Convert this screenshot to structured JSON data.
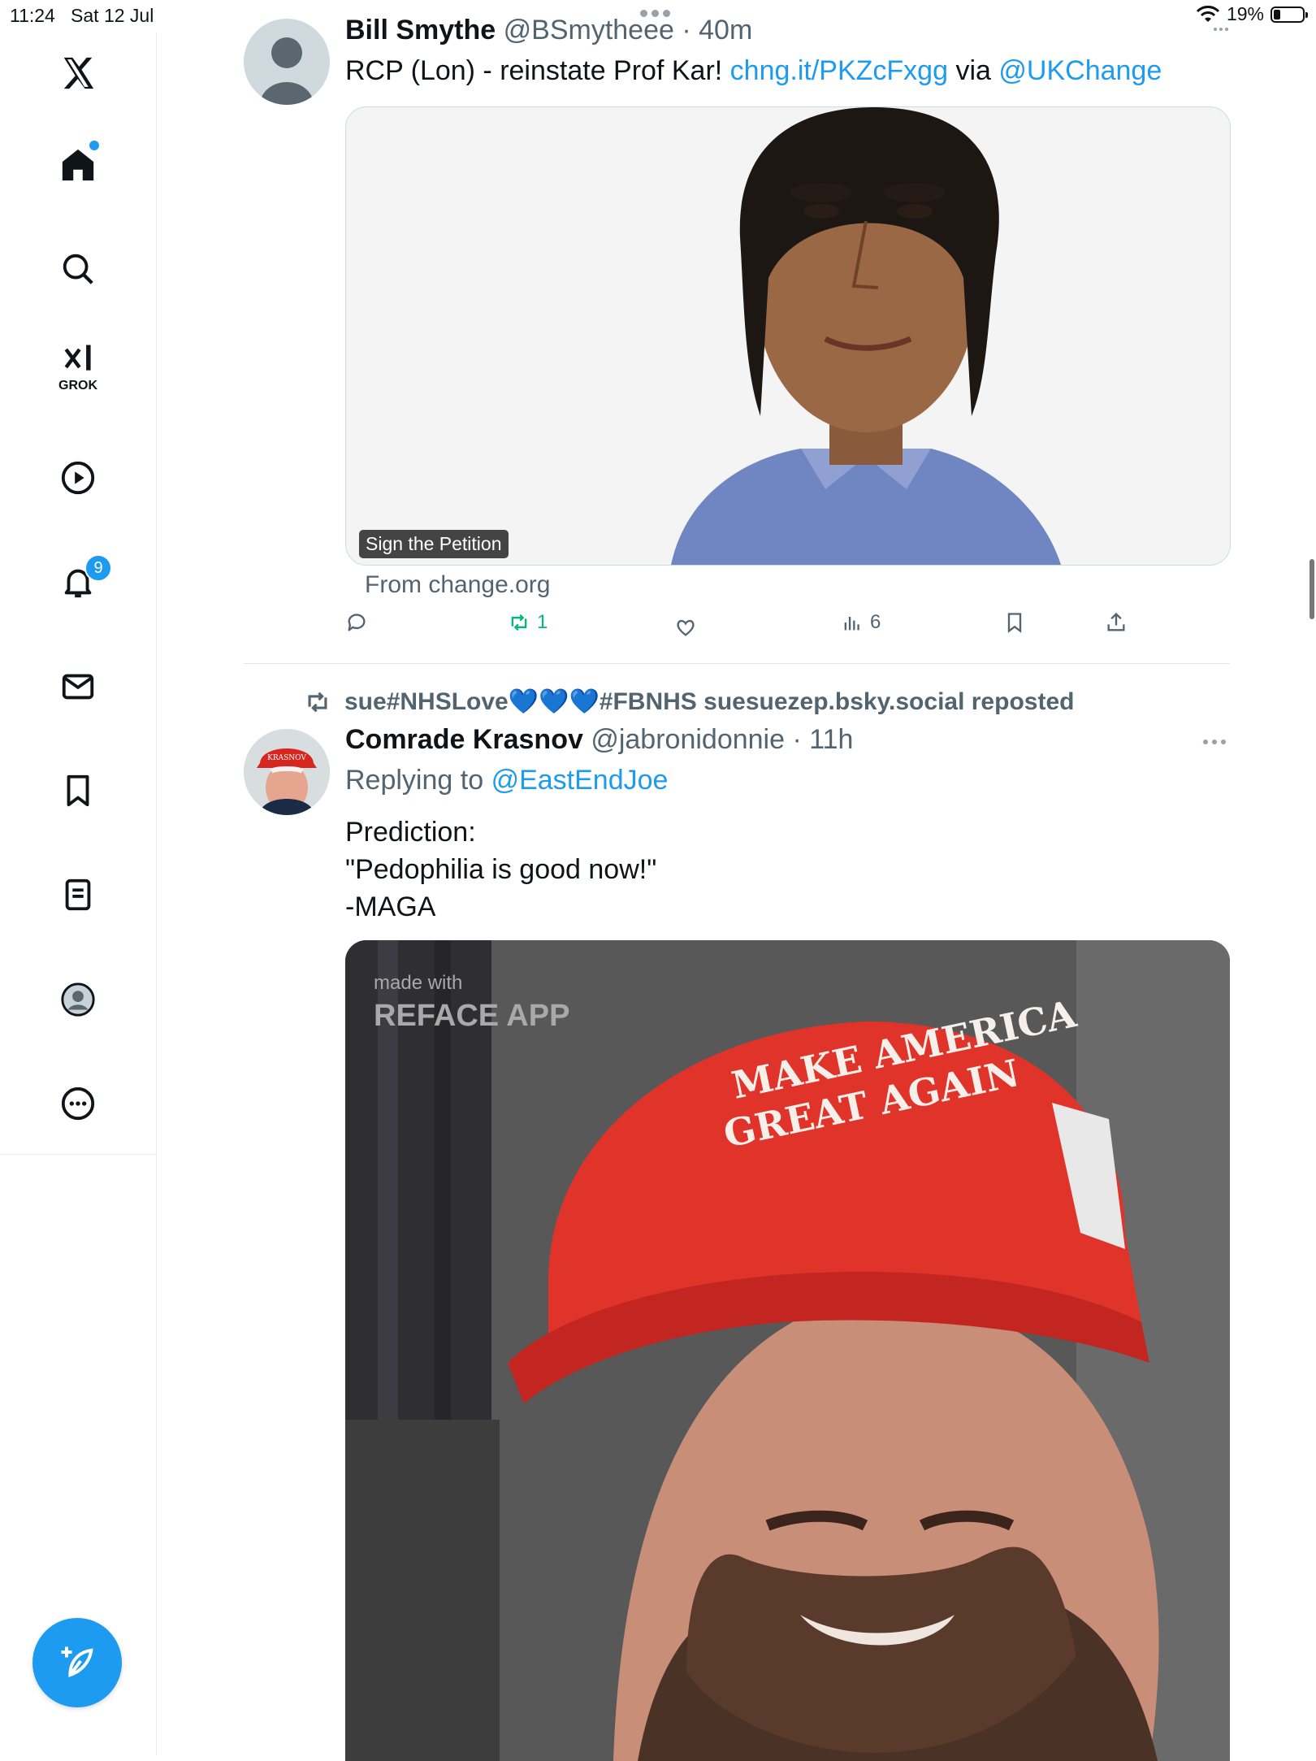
{
  "status_bar": {
    "time": "11:24",
    "date": "Sat 12 Jul",
    "battery": "19%",
    "battery_level": 0.19
  },
  "sidebar": {
    "items": [
      {
        "name": "x-logo-icon"
      },
      {
        "name": "home-icon",
        "has_dot": true
      },
      {
        "name": "search-icon"
      },
      {
        "name": "grok-icon",
        "label": "GROK"
      },
      {
        "name": "video-icon"
      },
      {
        "name": "notifications-icon",
        "badge": "9"
      },
      {
        "name": "messages-icon"
      },
      {
        "name": "bookmarks-icon"
      },
      {
        "name": "lists-icon"
      },
      {
        "name": "profile-icon"
      },
      {
        "name": "more-icon"
      }
    ],
    "compose_icon": "compose-icon"
  },
  "tweet1": {
    "name": "Bill Smythe",
    "handle": "@BSmytheee",
    "time": "40m",
    "text_prefix": "RCP (Lon) - reinstate Prof Kar!",
    "link": "chng.it/PKZcFxgg",
    "via": "via",
    "mention": "@UKChange",
    "card_badge": "Sign the Petition",
    "from": "From change.org",
    "retweets": "1",
    "views": "6"
  },
  "tweet2": {
    "repost_text": "sue#NHSLove💙💙💙#FBNHS suesuezep.bsky.social reposted",
    "name": "Comrade Krasnov",
    "handle": "@jabronidonnie",
    "time": "11h",
    "replying_prefix": "Replying to",
    "replying_to": "@EastEndJoe",
    "text_lines": [
      "Prediction:",
      "\"Pedophilia is good now!\"",
      "-MAGA"
    ],
    "media_watermark_line1": "made with",
    "media_watermark_line2": "REFACE APP",
    "hat_text_line1": "MAKE AMERICA",
    "hat_text_line2": "GREAT AGAIN",
    "avatar_hat_text": "KRASNOV"
  }
}
